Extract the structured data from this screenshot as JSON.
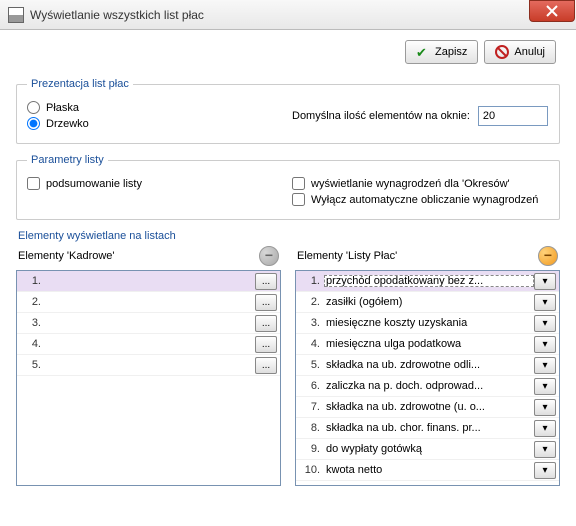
{
  "window": {
    "title": "Wyświetlanie wszystkich list płac"
  },
  "toolbar": {
    "save": "Zapisz",
    "cancel": "Anuluj"
  },
  "presentation": {
    "legend": "Prezentacja list płac",
    "flat": "Płaska",
    "tree": "Drzewko",
    "default_count_label": "Domyślna ilość elementów na oknie:",
    "default_count_value": "20"
  },
  "params": {
    "legend": "Parametry listy",
    "summary": "podsumowanie listy",
    "periods": "wyświetlanie wynagrodzeń dla 'Okresów'",
    "disable_auto": "Wyłącz automatyczne obliczanie wynagrodzeń"
  },
  "elements": {
    "legend": "Elementy wyświetlane na listach",
    "hr_header": "Elementy 'Kadrowe'",
    "payroll_header": "Elementy 'Listy Płac'",
    "hr_items": [
      {
        "n": "1.",
        "label": ""
      },
      {
        "n": "2.",
        "label": ""
      },
      {
        "n": "3.",
        "label": ""
      },
      {
        "n": "4.",
        "label": ""
      },
      {
        "n": "5.",
        "label": ""
      }
    ],
    "payroll_items": [
      {
        "n": "1.",
        "label": "przychód opodatkowany bez z..."
      },
      {
        "n": "2.",
        "label": "zasiłki (ogółem)"
      },
      {
        "n": "3.",
        "label": "miesięczne koszty uzyskania"
      },
      {
        "n": "4.",
        "label": "miesięczna ulga podatkowa"
      },
      {
        "n": "5.",
        "label": "składka na ub. zdrowotne odli..."
      },
      {
        "n": "6.",
        "label": "zaliczka na p. doch. odprowad..."
      },
      {
        "n": "7.",
        "label": "składka na ub. zdrowotne (u. o..."
      },
      {
        "n": "8.",
        "label": "składka na ub. chor. finans. pr..."
      },
      {
        "n": "9.",
        "label": "do wypłaty gotówką"
      },
      {
        "n": "10.",
        "label": "kwota netto"
      }
    ],
    "ellipsis": "...",
    "dropdown": "▾"
  }
}
